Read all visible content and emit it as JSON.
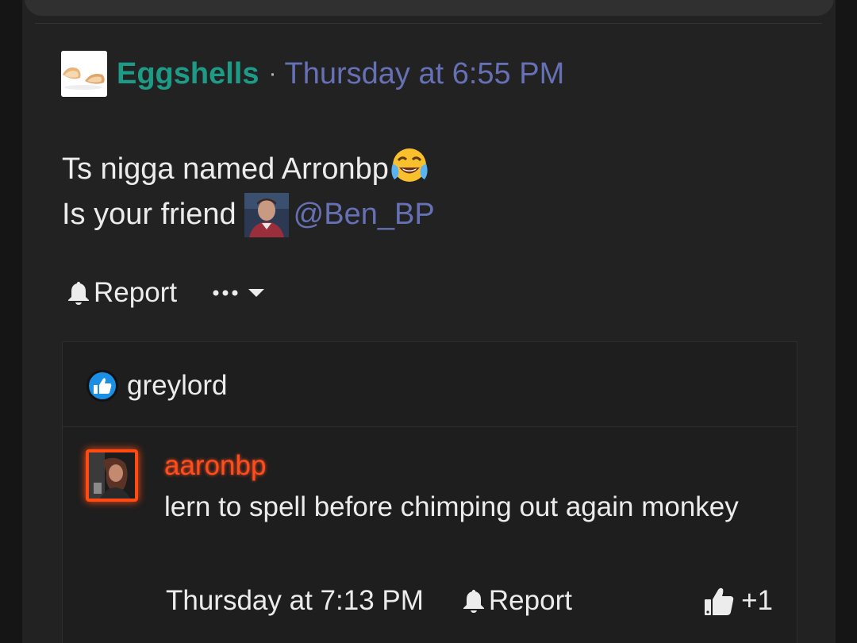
{
  "post": {
    "author": "Eggshells",
    "separator": "·",
    "timestamp": "Thursday at 6:55 PM",
    "body_line1": "Ts nigga named Arronbp",
    "body_line1_emoji": "face-with-tears-of-joy",
    "body_line2": "Is your friend ",
    "mention": "@Ben_BP",
    "actions": {
      "report_label": "Report",
      "more_icon": "ellipsis-icon",
      "caret_icon": "caret-down-icon"
    }
  },
  "reply": {
    "reaction_icon": "like-badge-icon",
    "reactor": "greylord",
    "author": "aaronbp",
    "text": "lern to spell before chimping out again monkey",
    "timestamp": "Thursday at 7:13 PM",
    "report_label": "Report",
    "like_count": "+1"
  },
  "colors": {
    "background": "#151515",
    "panel": "#222222",
    "author_teal": "#1e9b86",
    "link_blue": "#6670b4",
    "reply_author_orange": "#ff4d1e",
    "like_blue": "#1a8fe3",
    "text": "#ececec"
  }
}
